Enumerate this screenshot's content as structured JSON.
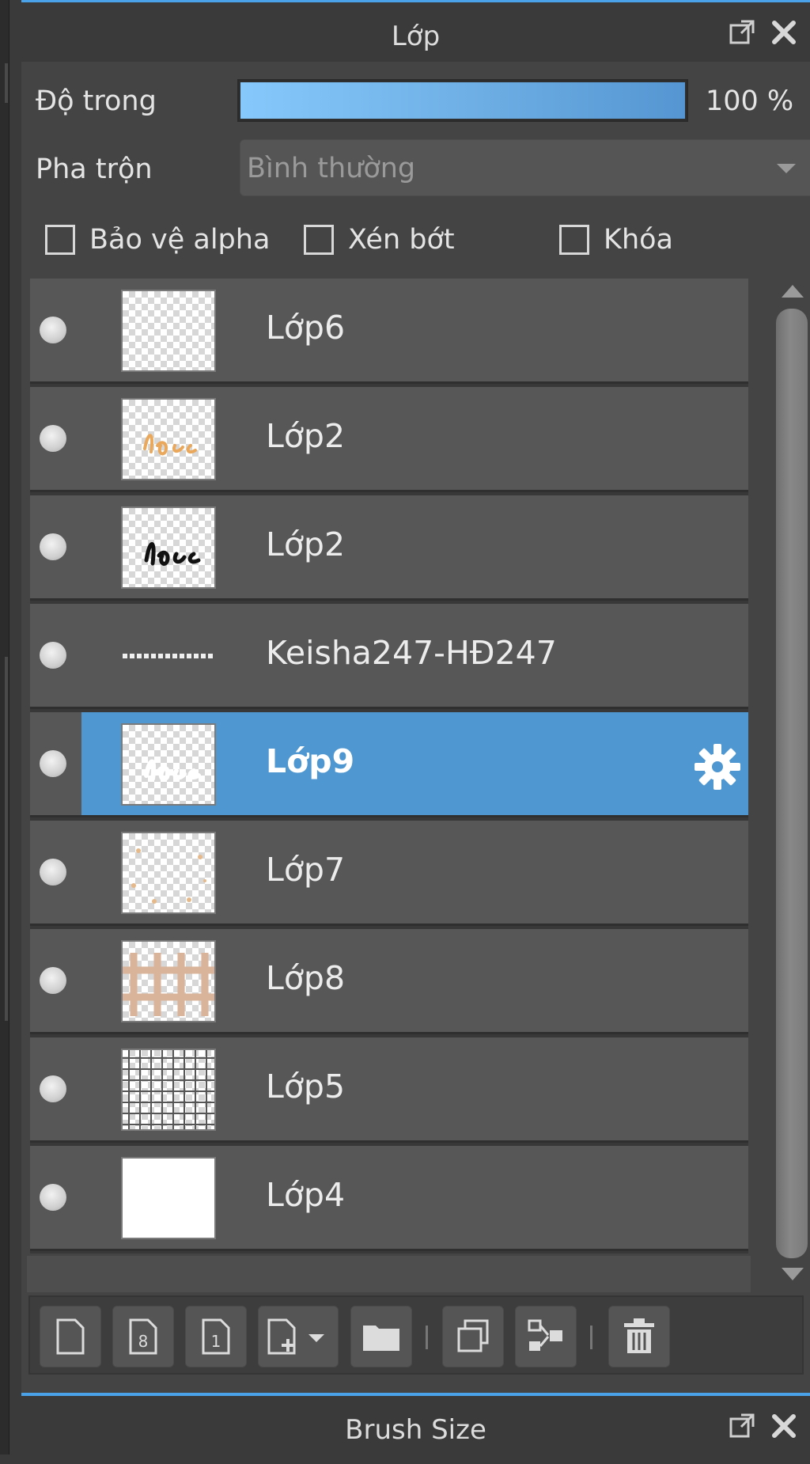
{
  "panel": {
    "title": "Lớp",
    "accent_color": "#4aa3e8",
    "popout_icon": "popout-icon",
    "close_icon": "close-icon"
  },
  "opacity": {
    "label": "Độ trong",
    "value_text": "100 %",
    "level": 1.0
  },
  "blend": {
    "label": "Pha trộn",
    "value": "Bình thường",
    "icon": "chevron-down-icon"
  },
  "checks": [
    {
      "label": "Bảo vệ alpha",
      "checked": false
    },
    {
      "label": "Xén bớt",
      "checked": false
    },
    {
      "label": "Khóa",
      "checked": false
    }
  ],
  "layers": [
    {
      "name": "Lớp6",
      "thumb": "transparent",
      "selected": false
    },
    {
      "name": "Lớp2",
      "thumb": "orange-script",
      "selected": false
    },
    {
      "name": "Lớp2",
      "thumb": "black-script",
      "selected": false
    },
    {
      "name": "Keisha247-HĐ247",
      "thumb": "text-line",
      "selected": false
    },
    {
      "name": "Lớp9",
      "thumb": "white-script",
      "selected": true
    },
    {
      "name": "Lớp7",
      "thumb": "dots",
      "selected": false
    },
    {
      "name": "Lớp8",
      "thumb": "fence",
      "selected": false
    },
    {
      "name": "Lớp5",
      "thumb": "grid",
      "selected": false
    },
    {
      "name": "Lớp4",
      "thumb": "white",
      "selected": false
    }
  ],
  "selected_color": "#4f97d0",
  "toolbar_icons": [
    "new-layer-icon",
    "new-8bit-layer-icon",
    "new-1bit-layer-icon",
    "add-layer-dropdown-icon",
    "new-folder-icon",
    "duplicate-layer-icon",
    "merge-down-icon",
    "delete-layer-icon"
  ],
  "bottom_panel": {
    "title": "Brush Size"
  }
}
